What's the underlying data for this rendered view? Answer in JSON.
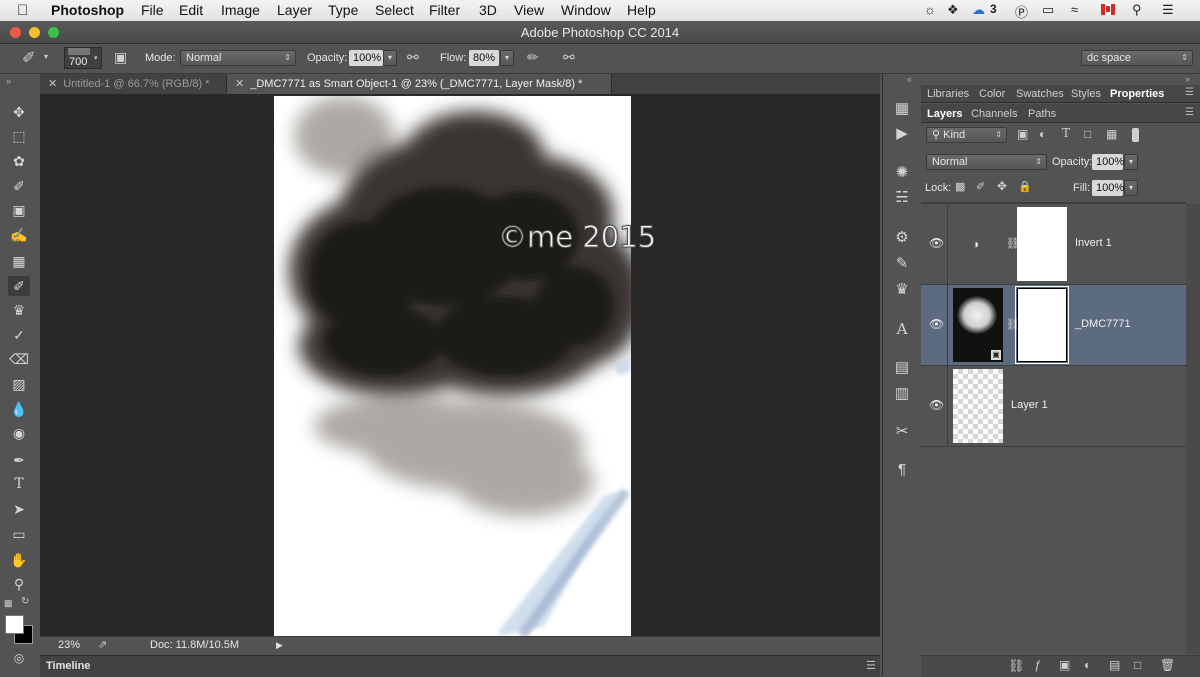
{
  "menubar": {
    "apple": "",
    "app": "Photoshop",
    "items": [
      "File",
      "Edit",
      "Image",
      "Layer",
      "Type",
      "Select",
      "Filter",
      "3D",
      "View",
      "Window",
      "Help"
    ],
    "status_badge": "3"
  },
  "window": {
    "title": "Adobe Photoshop CC 2014"
  },
  "options": {
    "brush_size": "700",
    "mode_label": "Mode:",
    "mode_value": "Normal",
    "opacity_label": "Opacity:",
    "opacity_value": "100%",
    "flow_label": "Flow:",
    "flow_value": "80%",
    "workspace": "dc space"
  },
  "tabs": [
    {
      "label": "Untitled-1 @ 66.7% (RGB/8) *",
      "active": false
    },
    {
      "label": "_DMC7771 as Smart Object-1 @ 23% (_DMC7771, Layer Mask/8) *",
      "active": true
    }
  ],
  "canvas": {
    "watermark": "©me 2015"
  },
  "status": {
    "zoom": "23%",
    "doc": "Doc: 11.8M/10.5M"
  },
  "timeline": {
    "label": "Timeline"
  },
  "panels": {
    "top_tabs": [
      "Libraries",
      "Color",
      "Swatches",
      "Styles",
      "Properties"
    ],
    "layer_tabs": [
      "Layers",
      "Channels",
      "Paths"
    ],
    "filter_kind": "Kind",
    "blend_mode": "Normal",
    "opacity_label": "Opacity:",
    "opacity_value": "100%",
    "lock_label": "Lock:",
    "fill_label": "Fill:",
    "fill_value": "100%",
    "layers": [
      {
        "name": "Invert 1",
        "selected": false
      },
      {
        "name": "_DMC7771",
        "selected": true
      },
      {
        "name": "Layer 1",
        "selected": false
      }
    ]
  },
  "colors": {
    "selection": "#5d6b80",
    "canvas_bg": "#282828",
    "panel_bg": "#535353"
  }
}
